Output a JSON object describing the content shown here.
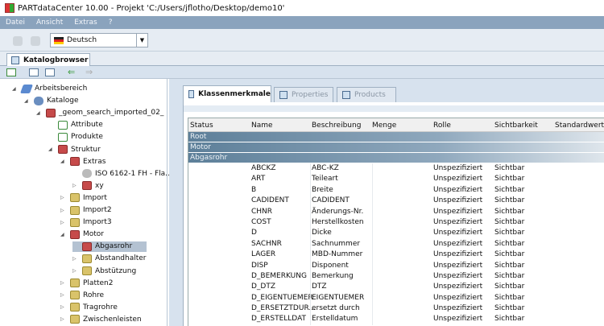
{
  "window": {
    "title": "PARTdataCenter 10.00 - Projekt 'C:/Users/jflotho/Desktop/demo10'"
  },
  "menu": [
    "Datei",
    "Ansicht",
    "Extras",
    "?"
  ],
  "toolbar": {
    "language": "Deutsch"
  },
  "main_tab": "Katalogbrowser",
  "tree": [
    {
      "label": "Arbeitsbereich",
      "level": 0,
      "icon": "workspace-icon",
      "exp": "open"
    },
    {
      "label": "Kataloge",
      "level": 1,
      "icon": "database-icon",
      "exp": "open"
    },
    {
      "label": "_geom_search_imported_02_",
      "level": 2,
      "icon": "catalog-icon",
      "exp": "open"
    },
    {
      "label": "Attribute",
      "level": 3,
      "icon": "attribute-icon",
      "exp": ""
    },
    {
      "label": "Produkte",
      "level": 3,
      "icon": "product-icon",
      "exp": ""
    },
    {
      "label": "Struktur",
      "level": 3,
      "icon": "folder-red-icon",
      "exp": "open"
    },
    {
      "label": "Extras",
      "level": 4,
      "icon": "folder-red-icon",
      "exp": "open"
    },
    {
      "label": "ISO 6162-1 FH - Fla...",
      "level": 5,
      "icon": "part-icon",
      "exp": ""
    },
    {
      "label": "xy",
      "level": 5,
      "icon": "folder-red-icon",
      "exp": "closed"
    },
    {
      "label": "Import",
      "level": 4,
      "icon": "folder-icon",
      "exp": "closed"
    },
    {
      "label": "Import2",
      "level": 4,
      "icon": "folder-icon",
      "exp": "closed"
    },
    {
      "label": "Import3",
      "level": 4,
      "icon": "folder-icon",
      "exp": "closed"
    },
    {
      "label": "Motor",
      "level": 4,
      "icon": "folder-red-icon",
      "exp": "open"
    },
    {
      "label": "Abgasrohr",
      "level": 5,
      "icon": "folder-red-icon",
      "exp": "",
      "selected": true
    },
    {
      "label": "Abstandhalter",
      "level": 5,
      "icon": "folder-icon",
      "exp": "closed"
    },
    {
      "label": "Abstützung",
      "level": 5,
      "icon": "folder-icon",
      "exp": "closed"
    },
    {
      "label": "Platten2",
      "level": 4,
      "icon": "folder-icon",
      "exp": "closed"
    },
    {
      "label": "Rohre",
      "level": 4,
      "icon": "folder-icon",
      "exp": "closed"
    },
    {
      "label": "Tragrohre",
      "level": 4,
      "icon": "folder-icon",
      "exp": "closed"
    },
    {
      "label": "Zwischenleisten",
      "level": 4,
      "icon": "folder-icon",
      "exp": "closed"
    }
  ],
  "panel_tabs": [
    "Klassenmerkmale",
    "Properties",
    "Products"
  ],
  "columns": [
    "Status",
    "Name",
    "Beschreibung",
    "Menge",
    "Rolle",
    "Sichtbarkeit",
    "Standardwert"
  ],
  "groups": [
    "Root",
    "Motor",
    "Abgasrohr"
  ],
  "rows": [
    [
      "ABCKZ",
      "ABC-KZ"
    ],
    [
      "ART",
      "Teileart"
    ],
    [
      "B",
      "Breite"
    ],
    [
      "CADIDENT",
      "CADIDENT"
    ],
    [
      "CHNR",
      "Änderungs-Nr."
    ],
    [
      "COST",
      "Herstellkosten"
    ],
    [
      "D",
      "Dicke"
    ],
    [
      "SACHNR",
      "Sachnummer"
    ],
    [
      "LAGER",
      "MBD-Nummer"
    ],
    [
      "DISP",
      "Disponent"
    ],
    [
      "D_BEMERKUNG",
      "Bemerkung"
    ],
    [
      "D_DTZ",
      "DTZ"
    ],
    [
      "D_EIGENTUEMER",
      "EIGENTUEMER"
    ],
    [
      "D_ERSETZTDUR...",
      "ersetzt durch"
    ],
    [
      "D_ERSTELLDAT",
      "Erstelldatum"
    ]
  ],
  "row_role": "Unspezifiziert",
  "row_visibility": "Sichtbar"
}
